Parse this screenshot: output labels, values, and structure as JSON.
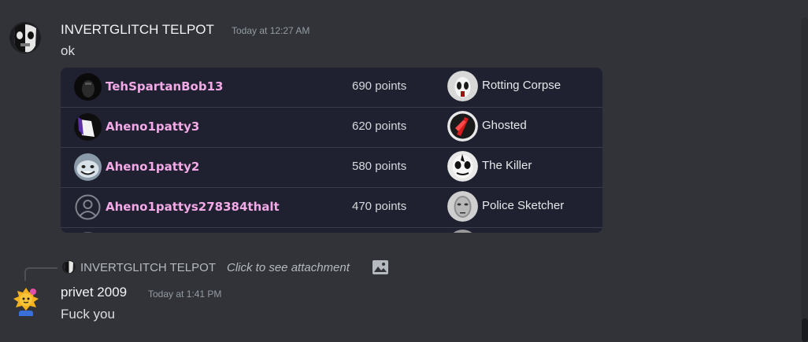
{
  "message1": {
    "author": "INVERTGLITCH TELPOT",
    "timestamp": "Today at 12:27 AM",
    "content": "ok",
    "avatar_icon": "ghost-mask-avatar"
  },
  "leaderboard": {
    "rows": [
      {
        "name": "TehSpartanBob13",
        "points": "690 points",
        "rank": "Rotting Corpse",
        "avatar_icon": "dark-figure-avatar",
        "rank_icon": "rotting-corpse-icon"
      },
      {
        "name": "Aheno1patty3",
        "points": "620 points",
        "rank": "Ghosted",
        "avatar_icon": "purple-white-avatar",
        "rank_icon": "ghosted-icon"
      },
      {
        "name": "Aheno1patty2",
        "points": "580 points",
        "rank": "The Killer",
        "avatar_icon": "grinning-face-avatar",
        "rank_icon": "the-killer-icon"
      },
      {
        "name": "Aheno1pattys278384thalt",
        "points": "470 points",
        "rank": "Police Sketcher",
        "avatar_icon": "default-user-avatar",
        "rank_icon": "police-sketcher-icon"
      }
    ]
  },
  "reply": {
    "author": "INVERTGLITCH TELPOT",
    "hint": "Click to see attachment"
  },
  "message2": {
    "author": "privet 2009",
    "timestamp": "Today at 1:41 PM",
    "content": "Fuck you",
    "avatar_icon": "yellow-creature-avatar"
  },
  "colors": {
    "background": "#313338",
    "embed_background": "#1f2130",
    "leaderboard_name": "#f4a9e7"
  }
}
